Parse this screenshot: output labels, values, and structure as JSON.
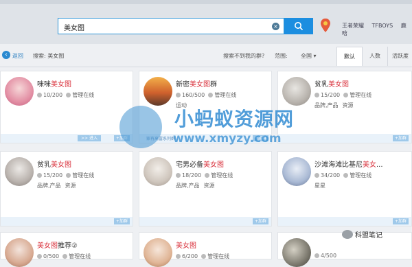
{
  "search": {
    "query": "美女图"
  },
  "top_links": [
    "王者荣耀",
    "TFBOYS",
    "鹿晗"
  ],
  "filter": {
    "back_label": "返回",
    "breadcrumb": "搜索: 美女图",
    "not_found": "搜索不到我的群?",
    "range_label": "范围:",
    "range_value": "全国",
    "sort_tabs": [
      "默认",
      "人数",
      "活跃度"
    ]
  },
  "add_label": "+加群",
  "enter_label": ">> 进入",
  "cards": [
    {
      "pre": "咪咪",
      "hl": "美女图",
      "post": "",
      "count": "10/200",
      "admin": "管理在线",
      "tags": [],
      "enter": true
    },
    {
      "pre": "新密",
      "hl": "美女图",
      "post": "群",
      "count": "160/500",
      "admin": "管理在线",
      "tags": [
        "运动"
      ],
      "extra": "家有高富系列群"
    },
    {
      "pre": "贫乳",
      "hl": "美女图",
      "post": "",
      "count": "15/200",
      "admin": "管理在线",
      "tags": [
        "品牌,产品",
        "资源"
      ]
    },
    {
      "pre": "贫乳",
      "hl": "美女图",
      "post": "",
      "count": "15/200",
      "admin": "管理在线",
      "tags": [
        "品牌,产品",
        "资源"
      ]
    },
    {
      "pre": "宅男必备",
      "hl": "美女图",
      "post": "",
      "count": "18/200",
      "admin": "管理在线",
      "tags": [
        "品牌,产品",
        "资源"
      ]
    },
    {
      "pre": "沙滩海滩比基尼",
      "hl": "美女",
      "post": "...",
      "count": "34/200",
      "admin": "管理在线",
      "tags": [
        "星星"
      ]
    },
    {
      "pre": "",
      "hl": "美女图",
      "post": "推荐②",
      "count": "0/500",
      "admin": "管理在线",
      "tags": []
    },
    {
      "pre": "",
      "hl": "美女图",
      "post": "",
      "count": "6/200",
      "admin": "管理在线",
      "tags": []
    },
    {
      "pre": "",
      "hl": "",
      "post": "",
      "count": "4/500",
      "admin": "",
      "tags": []
    }
  ],
  "watermark": {
    "title": "小蚂蚁资源网",
    "url": "www.xmyzy.com"
  },
  "wechat_label": "科盟笔记"
}
